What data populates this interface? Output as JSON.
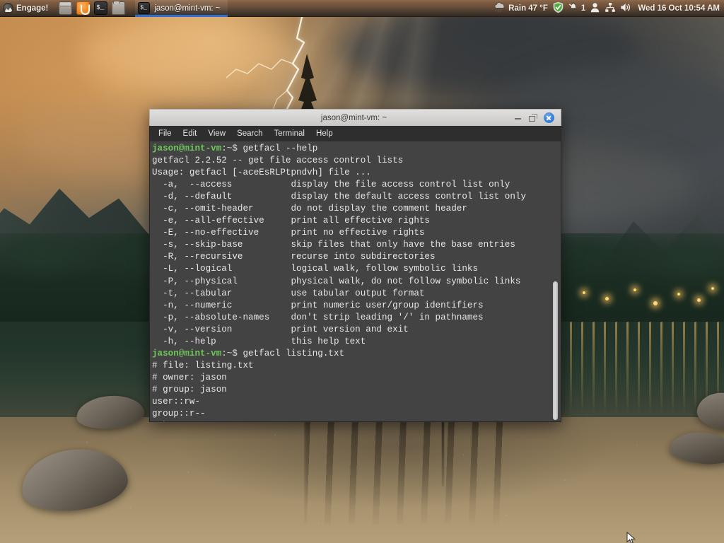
{
  "taskbar": {
    "menu_button": {
      "label": "Engage!",
      "icon": "mint-logo-icon"
    },
    "launchers": [
      {
        "name": "show-desktop",
        "icon": "window-icon",
        "label": ""
      },
      {
        "name": "web-browser",
        "icon": "firefox-icon",
        "label": ""
      },
      {
        "name": "terminal",
        "icon": "terminal-icon",
        "label": "$_"
      },
      {
        "name": "file-manager",
        "icon": "folder-icon",
        "label": ""
      }
    ],
    "windows": [
      {
        "title": "jason@mint-vm: ~",
        "icon": "terminal-icon",
        "icon_label": "$_",
        "active": true
      }
    ],
    "tray": {
      "weather": {
        "icon": "rain-cloud-icon",
        "text": "Rain 47 °F"
      },
      "shield": {
        "icon": "shield-check-icon"
      },
      "updates": {
        "icon": "bell-icon",
        "count": "1"
      },
      "user": {
        "icon": "user-icon"
      },
      "network": {
        "icon": "network-icon"
      },
      "volume": {
        "icon": "speaker-icon"
      },
      "clock": "Wed 16 Oct 10:54 AM"
    }
  },
  "terminal": {
    "title": "jason@mint-vm: ~",
    "controls": {
      "minimize": "minimize-button",
      "maximize": "restore-button",
      "close": "close-button"
    },
    "menu": [
      "File",
      "Edit",
      "View",
      "Search",
      "Terminal",
      "Help"
    ],
    "prompt_user_host": "jason@mint-vm",
    "prompt_path": ":~$",
    "commands": [
      "getfacl --help",
      "getfacl listing.txt"
    ],
    "colors": {
      "background": "#434343",
      "foreground": "#e6e6e6",
      "prompt_green": "#6ec75b",
      "titlebar": "#d5d3d1",
      "menubar": "#2e2e2e",
      "close_button": "#3b82d8",
      "taskbar_accent": "#2f6fd0"
    },
    "lines": [
      {
        "type": "prompt",
        "cmd": "getfacl --help"
      },
      {
        "type": "out",
        "text": "getfacl 2.2.52 -- get file access control lists"
      },
      {
        "type": "out",
        "text": "Usage: getfacl [-aceEsRLPtpndvh] file ..."
      },
      {
        "type": "out",
        "text": "  -a,  --access           display the file access control list only"
      },
      {
        "type": "out",
        "text": "  -d, --default           display the default access control list only"
      },
      {
        "type": "out",
        "text": "  -c, --omit-header       do not display the comment header"
      },
      {
        "type": "out",
        "text": "  -e, --all-effective     print all effective rights"
      },
      {
        "type": "out",
        "text": "  -E, --no-effective      print no effective rights"
      },
      {
        "type": "out",
        "text": "  -s, --skip-base         skip files that only have the base entries"
      },
      {
        "type": "out",
        "text": "  -R, --recursive         recurse into subdirectories"
      },
      {
        "type": "out",
        "text": "  -L, --logical           logical walk, follow symbolic links"
      },
      {
        "type": "out",
        "text": "  -P, --physical          physical walk, do not follow symbolic links"
      },
      {
        "type": "out",
        "text": "  -t, --tabular           use tabular output format"
      },
      {
        "type": "out",
        "text": "  -n, --numeric           print numeric user/group identifiers"
      },
      {
        "type": "out",
        "text": "  -p, --absolute-names    don't strip leading '/' in pathnames"
      },
      {
        "type": "out",
        "text": "  -v, --version           print version and exit"
      },
      {
        "type": "out",
        "text": "  -h, --help              this help text"
      },
      {
        "type": "prompt",
        "cmd": "getfacl listing.txt"
      },
      {
        "type": "out",
        "text": "# file: listing.txt"
      },
      {
        "type": "out",
        "text": "# owner: jason"
      },
      {
        "type": "out",
        "text": "# group: jason"
      },
      {
        "type": "out",
        "text": "user::rw-"
      },
      {
        "type": "out",
        "text": "group::r--"
      },
      {
        "type": "out",
        "text": "other::r--"
      },
      {
        "type": "out",
        "text": ""
      },
      {
        "type": "prompt",
        "cmd": "",
        "cursor": true
      }
    ]
  },
  "desktop": {
    "wallpaper_description": "Stormy mountain lake at dusk with lightning bolt, lone tree silhouette and warm distant lights"
  }
}
